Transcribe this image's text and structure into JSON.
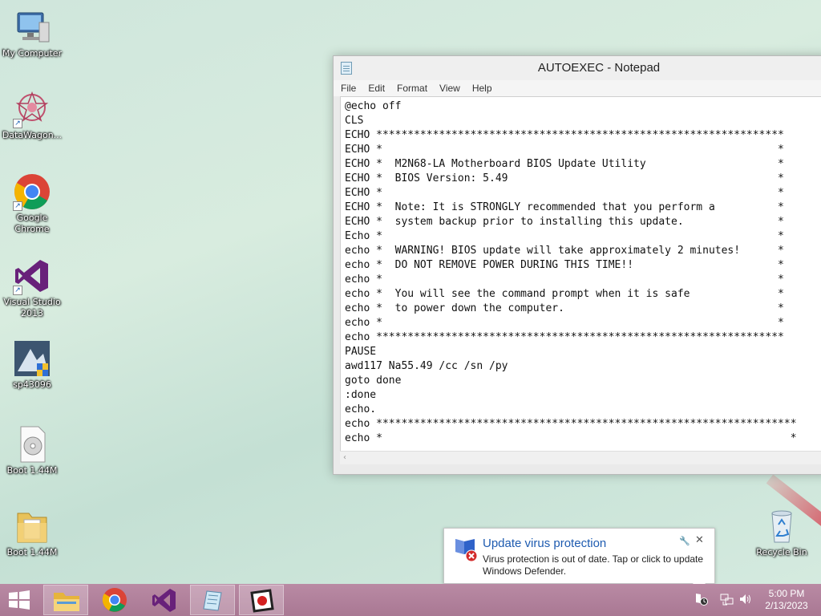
{
  "desktop": {
    "icons": [
      {
        "label": "My Computer"
      },
      {
        "label": "DataWagon..."
      },
      {
        "label": "Google Chrome"
      },
      {
        "label": "Visual Studio 2013"
      },
      {
        "label": "sp43096"
      },
      {
        "label": "Boot 1.44M"
      },
      {
        "label": "Boot 1.44M"
      },
      {
        "label": "Recycle Bin"
      }
    ]
  },
  "notepad": {
    "title": "AUTOEXEC - Notepad",
    "menu": [
      "File",
      "Edit",
      "Format",
      "View",
      "Help"
    ],
    "content": "@echo off\nCLS\nECHO *****************************************************************\nECHO *                                                               *\nECHO *  M2N68-LA Motherboard BIOS Update Utility                     *\nECHO *  BIOS Version: 5.49                                           *\nECHO *                                                               *\nECHO *  Note: It is STRONGLY recommended that you perform a          *\nECHO *  system backup prior to installing this update.               *\nEcho *                                                               *\necho *  WARNING! BIOS update will take approximately 2 minutes!      *\necho *  DO NOT REMOVE POWER DURING THIS TIME!!                       *\necho *                                                               *\necho *  You will see the command prompt when it is safe              *\necho *  to power down the computer.                                  *\necho *                                                               *\necho *****************************************************************\nPAUSE\nawd117 Na55.49 /cc /sn /py\ngoto done\n:done\necho.\necho *******************************************************************\necho *                                                                 *"
  },
  "notification": {
    "title": "Update virus protection",
    "body": "Virus protection is out of date. Tap or click to update Windows Defender."
  },
  "taskbar": {
    "time": "5:00 PM",
    "date": "2/13/2023",
    "pinned": [
      "file-explorer",
      "chrome",
      "visual-studio",
      "notepad",
      "app"
    ]
  },
  "colors": {
    "taskbar": "#b08099",
    "toast_title": "#1e5bb0"
  }
}
